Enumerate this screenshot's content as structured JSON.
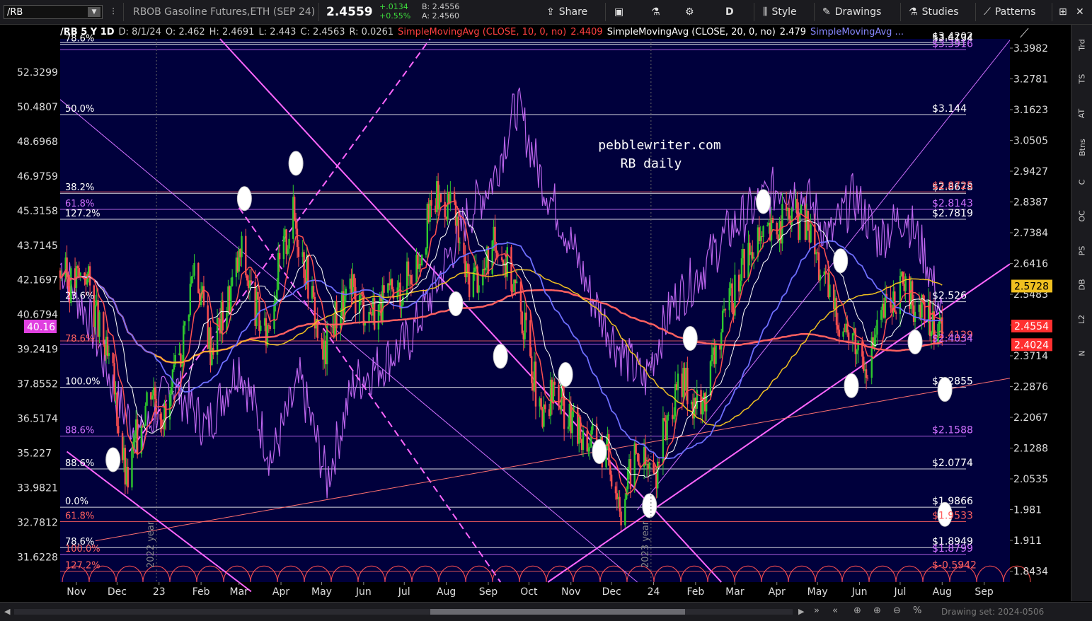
{
  "toolbar": {
    "symbol": "/RB",
    "description": "RBOB Gasoline Futures,ETH (SEP 24)",
    "last": "2.4559",
    "change": "+.0134",
    "change_pct": "+0.55%",
    "bid": "B: 2.4556",
    "ask": "A: 2.4560",
    "share": "Share",
    "period": "D",
    "style": "Style",
    "drawings": "Drawings",
    "studies": "Studies",
    "patterns": "Patterns"
  },
  "infobar": {
    "symbol_tf": "/RB 5 Y 1D",
    "date": "D: 8/1/24",
    "open": "O: 2.462",
    "high": "H: 2.4691",
    "low": "L: 2.443",
    "close": "C: 2.4563",
    "range": "R: 0.0261",
    "sma10_label": "SimpleMovingAvg (CLOSE, 10, 0, no)",
    "sma10_value": "2.4409",
    "sma20_label": "SimpleMovingAvg (CLOSE, 20, 0, no)",
    "sma20_value": "2.479",
    "sma_more": "SimpleMovingAvg ..."
  },
  "right_panel": [
    "Trd",
    "TS",
    "AT",
    "Btns",
    "C",
    "OC",
    "PS",
    "DB",
    "L2",
    "N"
  ],
  "bottom": {
    "drawing_set": "Drawing set: 2024-0506"
  },
  "watermark": [
    "pebblewriter.com",
    "RB daily"
  ],
  "colors": {
    "background": "#00003c",
    "candle_up": "#2ec92e",
    "candle_down": "#ff5050",
    "sma10": "#ff5050",
    "sma20": "#ffffff",
    "sma50": "#6e6eff",
    "sma100": "#f0c020",
    "sma200": "#ff6060",
    "overlay": "#d070ff",
    "trend": "#ff66ff"
  },
  "chart_data": {
    "type": "candlestick",
    "y_axis": {
      "range": [
        1.82,
        3.435
      ],
      "ticks": [
        3.3982,
        3.2781,
        3.1623,
        3.0505,
        2.9427,
        2.8387,
        2.7384,
        2.6416,
        2.5483,
        2.4583,
        2.3714,
        2.2876,
        2.2067,
        2.1288,
        2.0535,
        1.981,
        1.911,
        1.8434
      ],
      "scale": "log"
    },
    "left_axis": {
      "ticks": [
        "52.3299",
        "50.4807",
        "48.6968",
        "46.9759",
        "45.3158",
        "43.7145",
        "42.1697",
        "40.6794",
        "39.2419",
        "37.8552",
        "36.5174",
        "35.227",
        "33.9821",
        "32.7812",
        "31.6228"
      ],
      "current_label": "40.16"
    },
    "x_axis": {
      "range": [
        "2022-10-20",
        "2024-09-20"
      ],
      "ticks": [
        {
          "label": "Nov",
          "date": "2022-11-01"
        },
        {
          "label": "Dec",
          "date": "2022-12-01"
        },
        {
          "label": "23",
          "date": "2023-01-01"
        },
        {
          "label": "Feb",
          "date": "2023-02-01"
        },
        {
          "label": "Mar",
          "date": "2023-03-01"
        },
        {
          "label": "Apr",
          "date": "2023-04-01"
        },
        {
          "label": "May",
          "date": "2023-05-01"
        },
        {
          "label": "Jun",
          "date": "2023-06-01"
        },
        {
          "label": "Jul",
          "date": "2023-07-01"
        },
        {
          "label": "Aug",
          "date": "2023-08-01"
        },
        {
          "label": "Sep",
          "date": "2023-09-01"
        },
        {
          "label": "Oct",
          "date": "2023-10-01"
        },
        {
          "label": "Nov",
          "date": "2023-11-01"
        },
        {
          "label": "Dec",
          "date": "2023-12-01"
        },
        {
          "label": "24",
          "date": "2024-01-01"
        },
        {
          "label": "Feb",
          "date": "2024-02-01"
        },
        {
          "label": "Mar",
          "date": "2024-03-01"
        },
        {
          "label": "Apr",
          "date": "2024-04-01"
        },
        {
          "label": "May",
          "date": "2024-05-01"
        },
        {
          "label": "Jun",
          "date": "2024-06-01"
        },
        {
          "label": "Jul",
          "date": "2024-07-01"
        },
        {
          "label": "Aug",
          "date": "2024-08-01"
        },
        {
          "label": "Sep",
          "date": "2024-09-01"
        }
      ],
      "year_labels": [
        {
          "label": "2022 year",
          "date": "2022-12-28"
        },
        {
          "label": "2023 year",
          "date": "2023-12-28"
        }
      ]
    },
    "close_path": [
      [
        "2022-10-20",
        2.62
      ],
      [
        "2022-10-28",
        2.58
      ],
      [
        "2022-11-08",
        2.62
      ],
      [
        "2022-11-18",
        2.44
      ],
      [
        "2022-11-28",
        2.3
      ],
      [
        "2022-12-08",
        2.04
      ],
      [
        "2022-12-15",
        2.15
      ],
      [
        "2022-12-26",
        2.3
      ],
      [
        "2023-01-06",
        2.2
      ],
      [
        "2023-01-18",
        2.4
      ],
      [
        "2023-01-27",
        2.65
      ],
      [
        "2023-02-08",
        2.4
      ],
      [
        "2023-02-20",
        2.52
      ],
      [
        "2023-03-03",
        2.68
      ],
      [
        "2023-03-10",
        2.55
      ],
      [
        "2023-03-20",
        2.42
      ],
      [
        "2023-03-30",
        2.62
      ],
      [
        "2023-04-10",
        2.8
      ],
      [
        "2023-04-21",
        2.6
      ],
      [
        "2023-05-02",
        2.36
      ],
      [
        "2023-05-12",
        2.5
      ],
      [
        "2023-05-24",
        2.55
      ],
      [
        "2023-06-05",
        2.5
      ],
      [
        "2023-06-15",
        2.52
      ],
      [
        "2023-06-26",
        2.55
      ],
      [
        "2023-07-10",
        2.65
      ],
      [
        "2023-07-24",
        2.85
      ],
      [
        "2023-08-04",
        2.84
      ],
      [
        "2023-08-16",
        2.6
      ],
      [
        "2023-08-29",
        2.62
      ],
      [
        "2023-09-08",
        2.72
      ],
      [
        "2023-09-20",
        2.58
      ],
      [
        "2023-10-02",
        2.38
      ],
      [
        "2023-10-10",
        2.18
      ],
      [
        "2023-10-20",
        2.28
      ],
      [
        "2023-11-03",
        2.18
      ],
      [
        "2023-11-15",
        2.15
      ],
      [
        "2023-11-28",
        2.12
      ],
      [
        "2023-12-08",
        1.99
      ],
      [
        "2023-12-19",
        2.12
      ],
      [
        "2024-01-02",
        2.06
      ],
      [
        "2024-01-12",
        2.22
      ],
      [
        "2024-01-24",
        2.3
      ],
      [
        "2024-02-05",
        2.22
      ],
      [
        "2024-02-15",
        2.38
      ],
      [
        "2024-02-27",
        2.52
      ],
      [
        "2024-03-08",
        2.66
      ],
      [
        "2024-03-20",
        2.7
      ],
      [
        "2024-04-02",
        2.76
      ],
      [
        "2024-04-12",
        2.8
      ],
      [
        "2024-04-24",
        2.76
      ],
      [
        "2024-05-06",
        2.58
      ],
      [
        "2024-05-17",
        2.48
      ],
      [
        "2024-05-30",
        2.4
      ],
      [
        "2024-06-07",
        2.36
      ],
      [
        "2024-06-19",
        2.5
      ],
      [
        "2024-07-02",
        2.56
      ],
      [
        "2024-07-12",
        2.52
      ],
      [
        "2024-07-24",
        2.46
      ],
      [
        "2024-08-01",
        2.4563
      ]
    ],
    "overlay_path": [
      [
        "2022-10-20",
        2.64
      ],
      [
        "2022-11-10",
        2.48
      ],
      [
        "2022-12-01",
        2.25
      ],
      [
        "2022-12-20",
        2.15
      ],
      [
        "2023-01-10",
        2.3
      ],
      [
        "2023-02-05",
        2.18
      ],
      [
        "2023-03-01",
        2.35
      ],
      [
        "2023-03-25",
        2.1
      ],
      [
        "2023-04-15",
        2.3
      ],
      [
        "2023-05-05",
        2.05
      ],
      [
        "2023-05-25",
        2.3
      ],
      [
        "2023-06-15",
        2.35
      ],
      [
        "2023-07-05",
        2.42
      ],
      [
        "2023-07-25",
        2.58
      ],
      [
        "2023-08-15",
        2.78
      ],
      [
        "2023-09-05",
        2.92
      ],
      [
        "2023-09-22",
        3.18
      ],
      [
        "2023-10-10",
        2.92
      ],
      [
        "2023-10-28",
        2.75
      ],
      [
        "2023-11-15",
        2.55
      ],
      [
        "2023-12-05",
        2.4
      ],
      [
        "2023-12-25",
        2.3
      ],
      [
        "2024-01-15",
        2.52
      ],
      [
        "2024-02-05",
        2.62
      ],
      [
        "2024-02-25",
        2.74
      ],
      [
        "2024-03-15",
        2.82
      ],
      [
        "2024-04-05",
        2.9
      ],
      [
        "2024-04-25",
        2.84
      ],
      [
        "2024-05-10",
        2.72
      ],
      [
        "2024-05-28",
        2.86
      ],
      [
        "2024-06-15",
        2.72
      ],
      [
        "2024-07-05",
        2.8
      ],
      [
        "2024-07-20",
        2.66
      ],
      [
        "2024-08-01",
        2.48
      ]
    ],
    "horizontal_levels": [
      {
        "price": 3.4202,
        "label": "$3.4202",
        "color": "#ffffff"
      },
      {
        "price": 3.4134,
        "label": "$3.4134",
        "color": "#ffffff"
      },
      {
        "price": 3.3916,
        "label": "$3.3916",
        "color": "#d070ff"
      },
      {
        "price": 3.144,
        "label": "$3.144",
        "color": "#ffffff"
      },
      {
        "price": 2.8678,
        "label": "$2.8678",
        "color": "#ffffff"
      },
      {
        "price": 2.8725,
        "label": "$2.8725",
        "color": "#ff6060"
      },
      {
        "price": 2.8143,
        "label": "$2.8143",
        "color": "#d070ff"
      },
      {
        "price": 2.7819,
        "label": "$2.7819",
        "color": "#ffffff"
      },
      {
        "price": 2.526,
        "label": "$2.526",
        "color": "#ffffff"
      },
      {
        "price": 2.4129,
        "label": "$2.4129",
        "color": "#ff6060"
      },
      {
        "price": 2.4034,
        "label": "$2.4034",
        "color": "#d070ff"
      },
      {
        "price": 2.2855,
        "label": "$2.2855",
        "color": "#ffffff"
      },
      {
        "price": 2.1588,
        "label": "$2.1588",
        "color": "#d070ff"
      },
      {
        "price": 2.0774,
        "label": "$2.0774",
        "color": "#ffffff"
      },
      {
        "price": 1.9866,
        "label": "$1.9866",
        "color": "#ffffff"
      },
      {
        "price": 1.9533,
        "label": "$1.9533",
        "color": "#ff6060"
      },
      {
        "price": 1.8949,
        "label": "$1.8949",
        "color": "#ffffff"
      },
      {
        "price": 1.8799,
        "label": "$1.8799",
        "color": "#d070ff"
      },
      {
        "price": 1.8434,
        "label": "$-0.5942",
        "color": "#ff6060"
      }
    ],
    "fib_labels": [
      {
        "price": 3.144,
        "label": "50.0%",
        "color": "#ffffff"
      },
      {
        "price": 2.8678,
        "label": "38.2%",
        "color": "#ffffff"
      },
      {
        "price": 2.8143,
        "label": "61.8%",
        "color": "#d070ff"
      },
      {
        "price": 2.7819,
        "label": "127.2%",
        "color": "#ffffff"
      },
      {
        "price": 2.526,
        "label": "23.6%",
        "color": "#ffffff"
      },
      {
        "price": 2.4034,
        "label": "78.6%",
        "color": "#ff6060"
      },
      {
        "price": 2.2855,
        "label": "100.0%",
        "color": "#ffffff"
      },
      {
        "price": 2.1588,
        "label": "88.6%",
        "color": "#d070ff"
      },
      {
        "price": 2.0774,
        "label": "88.6%",
        "color": "#ffffff"
      },
      {
        "price": 1.9866,
        "label": "0.0%",
        "color": "#ffffff"
      },
      {
        "price": 1.9533,
        "label": "61.8%",
        "color": "#ff6060"
      },
      {
        "price": 1.8949,
        "label": "78.6%",
        "color": "#ffffff"
      },
      {
        "price": 1.8799,
        "label": "100.0%",
        "color": "#ff6060"
      },
      {
        "price": 1.8434,
        "label": "127.2%",
        "color": "#ff6060"
      },
      {
        "price": 3.4134,
        "label": "78.6%",
        "color": "#ffffff"
      }
    ],
    "trend_lines": [
      {
        "from": [
          "2022-10-25",
          2.12
        ],
        "to": [
          "2023-03-10",
          1.8
        ],
        "color": "#ff66ff",
        "width": 2,
        "dash": ""
      },
      {
        "from": [
          "2023-02-15",
          3.435
        ],
        "to": [
          "2024-02-20",
          1.82
        ],
        "color": "#ff66ff",
        "width": 2,
        "dash": ""
      },
      {
        "from": [
          "2023-03-01",
          2.82
        ],
        "to": [
          "2023-09-10",
          1.82
        ],
        "color": "#ff66ff",
        "width": 2,
        "dash": "10,6"
      },
      {
        "from": [
          "2022-12-10",
          2.12
        ],
        "to": [
          "2023-07-20",
          3.435
        ],
        "color": "#ff66ff",
        "width": 2,
        "dash": "10,6"
      },
      {
        "from": [
          "2023-10-15",
          1.82
        ],
        "to": [
          "2024-09-20",
          2.64
        ],
        "color": "#ff66ff",
        "width": 2,
        "dash": ""
      },
      {
        "from": [
          "2023-12-20",
          1.98
        ],
        "to": [
          "2024-09-20",
          3.43
        ],
        "color": "#d070ff",
        "width": 1,
        "dash": ""
      },
      {
        "from": [
          "2022-10-20",
          3.2
        ],
        "to": [
          "2023-12-20",
          1.82
        ],
        "color": "#d070ff",
        "width": 1,
        "dash": ""
      },
      {
        "from": [
          "2022-11-15",
          1.91
        ],
        "to": [
          "2024-09-20",
          2.31
        ],
        "color": "#ff7070",
        "width": 1,
        "dash": ""
      }
    ],
    "ellipses": [
      {
        "date": "2022-11-28",
        "price": 2.1
      },
      {
        "date": "2023-03-05",
        "price": 2.85
      },
      {
        "date": "2023-04-12",
        "price": 2.97
      },
      {
        "date": "2023-08-08",
        "price": 2.52
      },
      {
        "date": "2023-09-10",
        "price": 2.37
      },
      {
        "date": "2023-10-28",
        "price": 2.32
      },
      {
        "date": "2023-11-22",
        "price": 2.12
      },
      {
        "date": "2023-12-29",
        "price": 1.99
      },
      {
        "date": "2024-01-28",
        "price": 2.42
      },
      {
        "date": "2024-03-22",
        "price": 2.84
      },
      {
        "date": "2024-05-18",
        "price": 2.65
      },
      {
        "date": "2024-05-26",
        "price": 2.29
      },
      {
        "date": "2024-07-12",
        "price": 2.41
      },
      {
        "date": "2024-08-03",
        "price": 2.28
      },
      {
        "date": "2024-08-03",
        "price": 1.97
      }
    ],
    "price_tags": [
      {
        "price": 2.5728,
        "label": "2.5728",
        "color": "#f0c020",
        "text_color": "#000000"
      },
      {
        "price": 2.4554,
        "label": "2.4554",
        "color": "#ff3030",
        "text_color": "#ffffff"
      },
      {
        "price": 2.4024,
        "label": "2.4024",
        "color": "#ff3030",
        "text_color": "#ffffff"
      }
    ]
  }
}
